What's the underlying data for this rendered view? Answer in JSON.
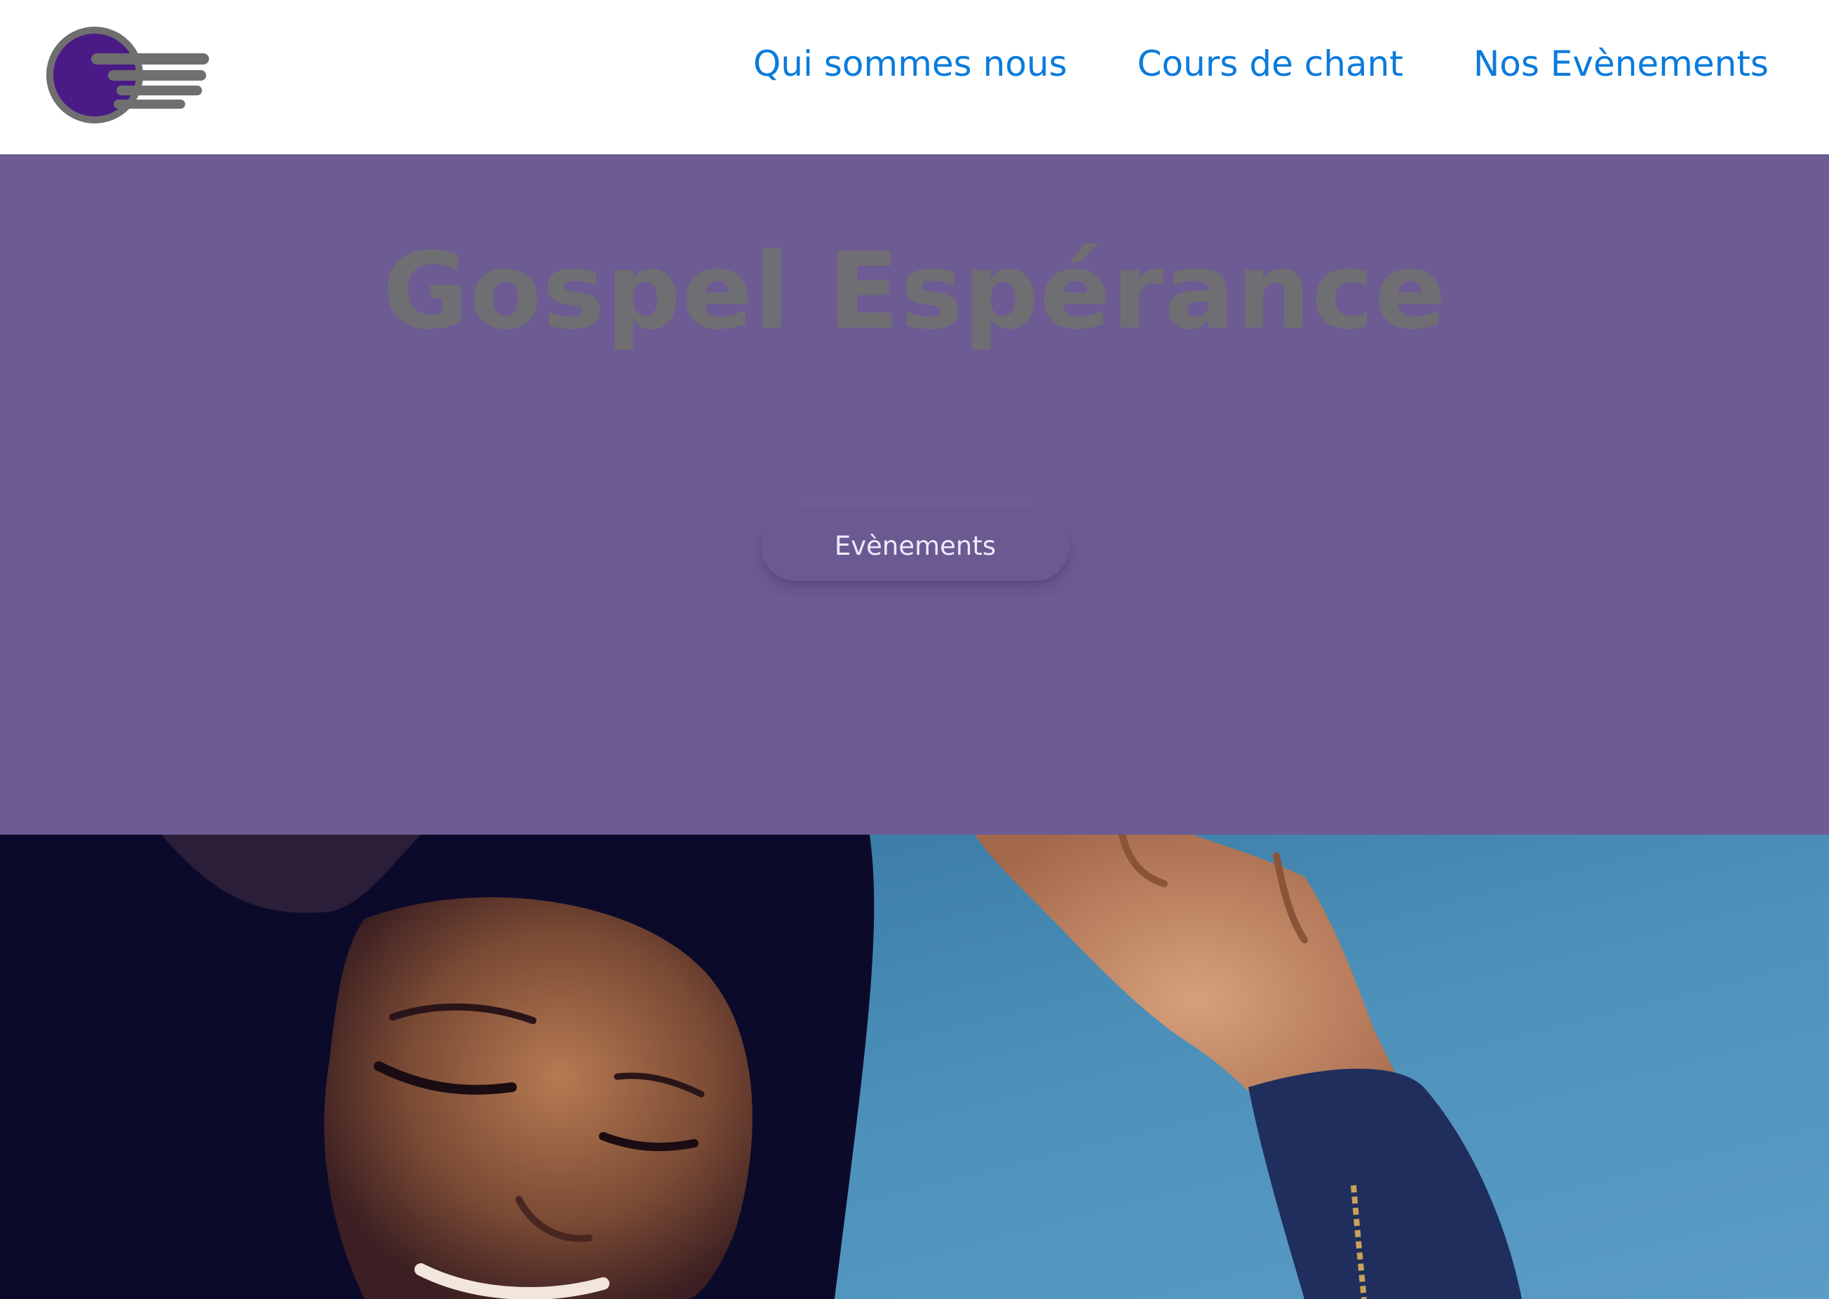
{
  "header": {
    "logo_icon": "comet-logo-icon",
    "nav": [
      {
        "label": "Qui sommes nous"
      },
      {
        "label": "Cours de chant"
      },
      {
        "label": "Nos Evènements"
      }
    ]
  },
  "hero": {
    "title": "Gospel Espérance",
    "button_label": "Evènements"
  },
  "photo": {
    "alt": "singer-photo"
  },
  "colors": {
    "nav_link": "#0a7bdc",
    "hero_background": "#6d5b93",
    "hero_title": "#6f6f73",
    "logo_purple": "#4a1a86",
    "logo_grey": "#6f6f6f",
    "photo_background": "#3f86b0"
  }
}
